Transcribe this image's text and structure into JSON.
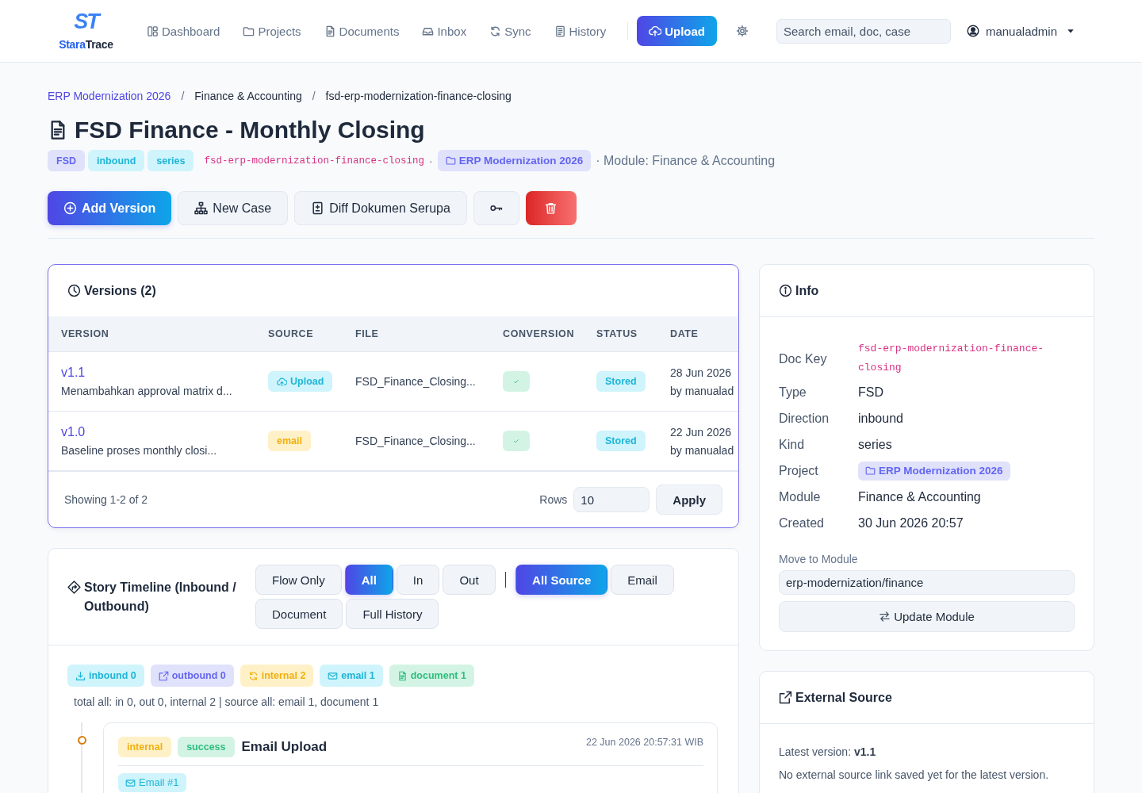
{
  "header": {
    "logo": {
      "mark": "ST",
      "name": [
        "Stara",
        "Trace"
      ]
    },
    "nav": [
      {
        "label": "Dashboard"
      },
      {
        "label": "Projects"
      },
      {
        "label": "Documents"
      },
      {
        "label": "Inbox"
      },
      {
        "label": "Sync"
      },
      {
        "label": "History"
      }
    ],
    "upload_button": "Upload",
    "search": {
      "placeholder": "Search email, doc, case"
    },
    "user": "manualadmin"
  },
  "breadcrumb": [
    {
      "label": "ERP Modernization 2026",
      "link": true
    },
    {
      "separator": "/",
      "label": "Finance & Accounting",
      "link": false
    },
    {
      "separator": "/",
      "label": "fsd-erp-modernization-finance-closing",
      "link": false
    }
  ],
  "document": {
    "title": "FSD Finance - Monthly Closing",
    "tags": [
      {
        "label": "FSD",
        "kind": "type"
      },
      {
        "label": "inbound",
        "kind": "direction"
      },
      {
        "label": "series",
        "kind": "category"
      }
    ],
    "doc_key": "fsd-erp-modernization-finance-closing",
    "separator": "·",
    "project": "ERP Modernization 2026",
    "module": "· Module: Finance & Accounting"
  },
  "actions": [
    {
      "kind": "primary",
      "label": "Add Version"
    },
    {
      "kind": "default",
      "label": "New Case"
    },
    {
      "kind": "default",
      "label": "Diff Dokumen Serupa"
    },
    {
      "kind": "icon"
    },
    {
      "kind": "danger"
    }
  ],
  "versions": {
    "title": "Versions (2)",
    "columns": [
      "VERSION",
      "SOURCE",
      "FILE",
      "CONVERSION",
      "STATUS",
      "DATE"
    ],
    "rows": [
      {
        "version": "v1.1",
        "note": "Menambahkan approval matrix d...",
        "source": {
          "label": "Upload",
          "kind": "upload"
        },
        "file": "FSD_Finance_Closing...",
        "converted": true,
        "status": {
          "label": "Stored",
          "kind": "stored"
        },
        "date": "28 Jun 2026",
        "author": "by manualad"
      },
      {
        "version": "v1.0",
        "note": "Baseline proses monthly closi...",
        "source": {
          "label": "email",
          "kind": "email"
        },
        "file": "FSD_Finance_Closing...",
        "converted": true,
        "status": {
          "label": "Stored",
          "kind": "stored"
        },
        "date": "22 Jun 2026",
        "author": "by manualad"
      }
    ],
    "footer": {
      "summary": "Showing 1-2 of 2",
      "rows_label": "Rows",
      "rows_value": "10",
      "apply_button": "Apply"
    }
  },
  "timeline": {
    "title": "Story Timeline (Inbound / Outbound)",
    "flow_filters": [
      {
        "label": "Flow Only",
        "selected": false
      },
      {
        "label": "All",
        "selected": true
      },
      {
        "label": "In",
        "selected": false
      },
      {
        "label": "Out",
        "selected": false
      }
    ],
    "source_filters": [
      {
        "label": "All Source",
        "selected": true
      },
      {
        "label": "Email",
        "selected": false
      },
      {
        "label": "Document",
        "selected": false
      },
      {
        "label": "Full History",
        "selected": false
      }
    ],
    "counts": [
      {
        "label": "inbound 0",
        "kind": "inbound"
      },
      {
        "label": "outbound 0",
        "kind": "outbound"
      },
      {
        "label": "internal 2",
        "kind": "internal"
      },
      {
        "label": "email 1",
        "kind": "email"
      },
      {
        "label": "document 1",
        "kind": "document"
      }
    ],
    "summary": "total all: in 0, out 0, internal 2 | source all: email 1, document 1",
    "events": [
      {
        "direction": {
          "label": "internal",
          "kind": "internal"
        },
        "status": {
          "label": "success",
          "kind": "success"
        },
        "title": "Email Upload",
        "time": "22 Jun 2026 20:57:31 WIB",
        "attachments": [
          {
            "label": "Email #1",
            "kind": "email"
          }
        ]
      }
    ]
  },
  "info": {
    "title": "Info",
    "fields": [
      {
        "label": "Doc Key",
        "value": "fsd-erp-modernization-finance-closing",
        "kind": "code"
      },
      {
        "label": "Type",
        "value": "FSD",
        "kind": "text"
      },
      {
        "label": "Direction",
        "value": "inbound",
        "kind": "text"
      },
      {
        "label": "Kind",
        "value": "series",
        "kind": "text"
      },
      {
        "label": "Project",
        "value": "ERP Modernization 2026",
        "kind": "project"
      },
      {
        "label": "Module",
        "value": "Finance & Accounting",
        "kind": "text"
      },
      {
        "label": "Created",
        "value": "30 Jun 2026 20:57",
        "kind": "text"
      }
    ],
    "move": {
      "label": "Move to Module",
      "value": "erp-modernization/finance",
      "button": "Update Module"
    }
  },
  "external_source": {
    "title": "External Source",
    "latest": "Latest version: **v1.1**",
    "message": "No external source link saved yet for the latest version."
  }
}
